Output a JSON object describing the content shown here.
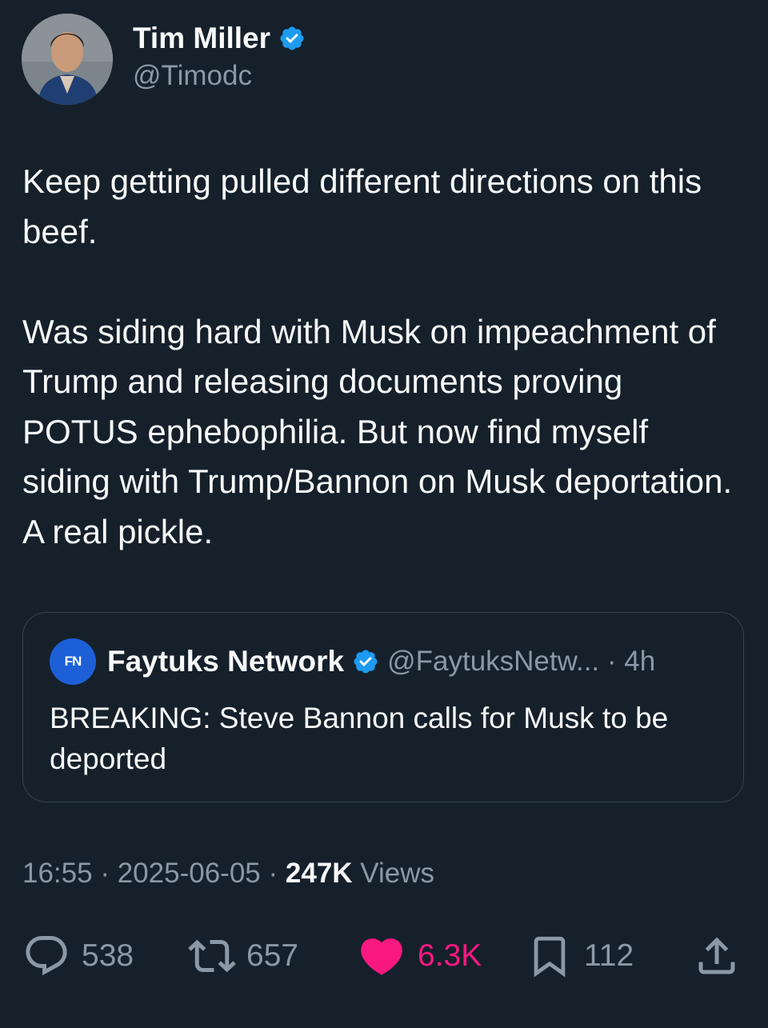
{
  "tweet": {
    "author_name": "Tim Miller",
    "author_handle": "@Timodc",
    "text": "Keep getting pulled different directions on this beef.\n\nWas siding hard with Musk on impeachment of Trump and releasing documents proving POTUS ephebophilia. But now find myself siding with Trump/Bannon on Musk deportation. A real pickle.",
    "time": "16:55",
    "date": "2025-06-05",
    "views_count": "247K",
    "views_label": "Views"
  },
  "quote": {
    "logo_text": "FN",
    "author_name": "Faytuks Network",
    "author_handle": "@FaytuksNetw...",
    "age": "4h",
    "text": "BREAKING: Steve Bannon calls for Musk to be deported"
  },
  "actions": {
    "replies": "538",
    "reposts": "657",
    "likes": "6.3K",
    "bookmarks": "112"
  },
  "colors": {
    "background": "#15202b",
    "verified": "#1d9bf0",
    "like": "#f91880",
    "muted": "#8b98a5"
  },
  "icons": [
    "verified-badge-icon",
    "reply-icon",
    "repost-icon",
    "heart-icon",
    "bookmark-icon",
    "share-icon"
  ]
}
